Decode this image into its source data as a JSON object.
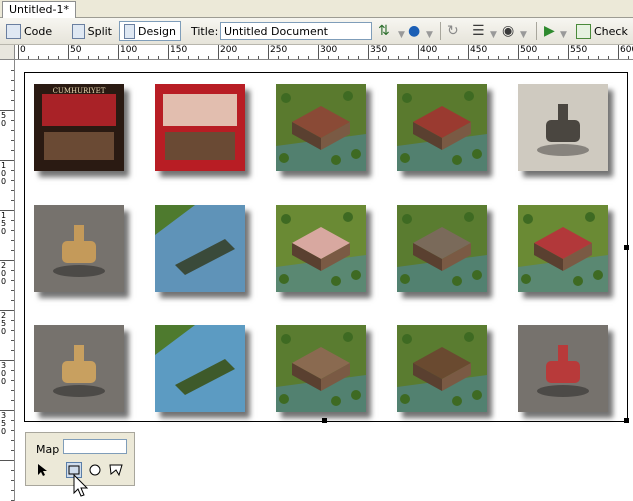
{
  "tab": {
    "label": "Untitled-1*"
  },
  "toolbar": {
    "code_label": "Code",
    "split_label": "Split",
    "design_label": "Design",
    "title_label": "Title:",
    "title_value": "Untitled Document",
    "check_label": "Check",
    "active_view": "Design"
  },
  "ruler": {
    "h_labels": [
      "0",
      "50",
      "100",
      "150",
      "200",
      "250",
      "300",
      "350",
      "400",
      "450",
      "500",
      "550",
      "600"
    ],
    "v_labels": [
      "50",
      "100",
      "150",
      "200",
      "250",
      "300",
      "350"
    ]
  },
  "gallery": {
    "rows": [
      [
        {
          "name": "cumhuriyet-cover",
          "title": "CUMHURIYET",
          "bg": "#2a1a12",
          "accent": "#c0242c"
        },
        {
          "name": "box-back",
          "bg": "#b81d24",
          "accent": "#e9dbc8"
        },
        {
          "name": "mansion-garden",
          "bg": "#5a7a2e",
          "accent": "#8a4a36"
        },
        {
          "name": "red-mansion",
          "bg": "#5a7a2e",
          "accent": "#9a3a30"
        },
        {
          "name": "vintage-car",
          "bg": "#cfcac0",
          "accent": "#4a4640"
        }
      ],
      [
        {
          "name": "horse-rider",
          "bg": "#76726d",
          "accent": "#c49a5a"
        },
        {
          "name": "steam-ship",
          "bg": "#5f93b8",
          "accent": "#3a4a3a"
        },
        {
          "name": "pink-building",
          "bg": "#6a8a34",
          "accent": "#d8a8a0"
        },
        {
          "name": "town-river",
          "bg": "#5a7c30",
          "accent": "#7a6a5a"
        },
        {
          "name": "red-roof-palace",
          "bg": "#6a8a34",
          "accent": "#b2383a"
        }
      ],
      [
        {
          "name": "ox-cart",
          "bg": "#76726d",
          "accent": "#c8a060"
        },
        {
          "name": "river-boats",
          "bg": "#5c9bc2",
          "accent": "#3e5a2a"
        },
        {
          "name": "stone-building",
          "bg": "#5a7c30",
          "accent": "#8a6a50"
        },
        {
          "name": "marching-troops",
          "bg": "#5a7c30",
          "accent": "#6a4a30"
        },
        {
          "name": "soldier-horse",
          "bg": "#76726d",
          "accent": "#b83a3a"
        }
      ]
    ]
  },
  "inspector": {
    "map_label": "Map",
    "map_value": ""
  }
}
